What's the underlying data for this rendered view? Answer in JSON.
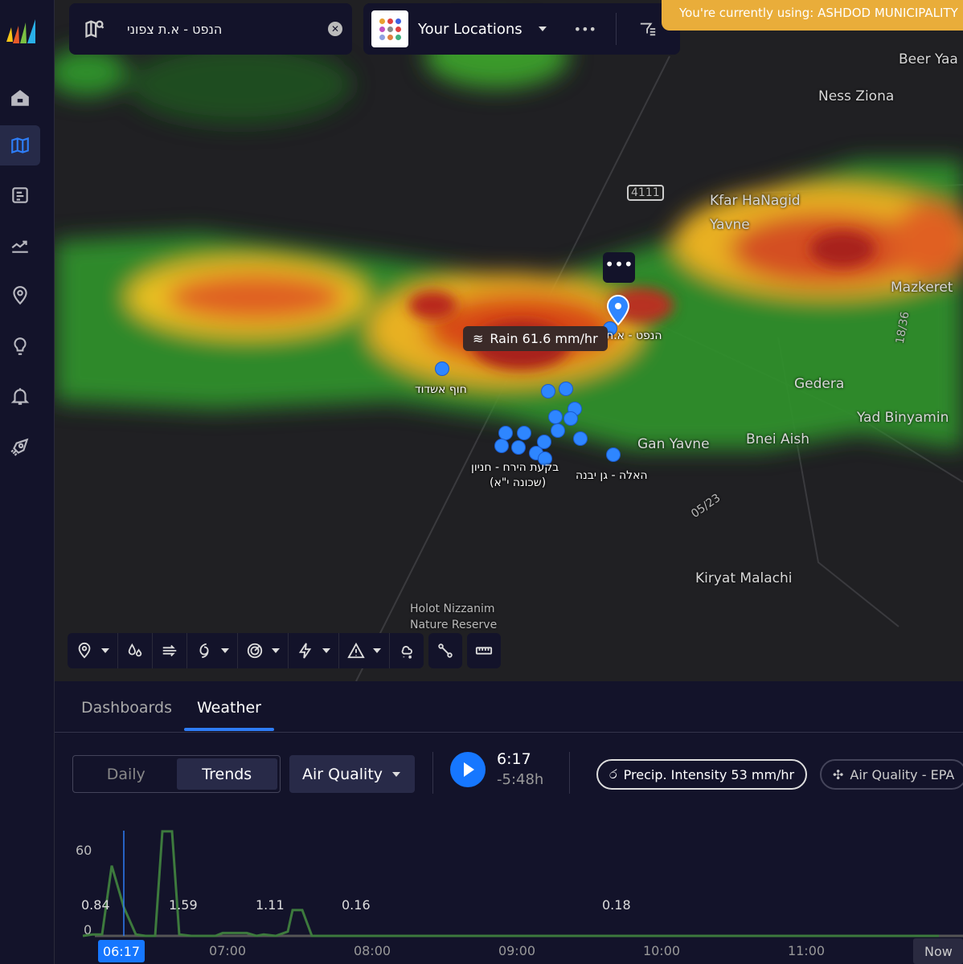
{
  "sidebar": {
    "items": [
      {
        "name": "home",
        "icon": "home-icon"
      },
      {
        "name": "map",
        "icon": "map-icon",
        "active": true
      },
      {
        "name": "reports",
        "icon": "report-icon"
      },
      {
        "name": "trends",
        "icon": "trend-icon"
      },
      {
        "name": "locations",
        "icon": "pin-icon"
      },
      {
        "name": "insights",
        "icon": "lightbulb-icon"
      },
      {
        "name": "alerts",
        "icon": "bell-icon"
      },
      {
        "name": "launch",
        "icon": "rocket-icon"
      }
    ]
  },
  "search": {
    "value": "הנפט - א.ת צפוני"
  },
  "locations": {
    "label": "Your Locations",
    "more": "•••"
  },
  "banner": {
    "text": "You're currently using: ASHDOD MUNICIPALITY"
  },
  "map": {
    "places": [
      "Beer Yaa",
      "Ness Ziona",
      "Kfar HaNagid",
      "Yavne",
      "Mazkeret",
      "Gedera",
      "Yad Binyamin",
      "Gan Yavne",
      "Bnei Aish",
      "Kiryat Malachi",
      "Holot Nizzanim",
      "Nature Reserve",
      "4111",
      "05/23",
      "18/36"
    ],
    "pin_labels": [
      "הנפט - א.ת",
      "חוף אשדוד",
      "בקעת הירח - חניון",
      "(שכונה י\"א)",
      "האלה - גן יבנה"
    ],
    "tooltip": "Rain 61.6 mm/hr",
    "more": "•••"
  },
  "toolbar": [
    "locations",
    "precipitation",
    "wind",
    "tropical",
    "radar",
    "lightning",
    "warnings",
    "winter",
    "route",
    "ruler"
  ],
  "panel": {
    "tabs": [
      "Dashboards",
      "Weather"
    ],
    "active_tab": "Weather",
    "segment": [
      "Daily",
      "Trends"
    ],
    "active_segment": "Trends",
    "dropdown": "Air Quality",
    "time": "6:17",
    "offset": "-5:48h",
    "chips": [
      "Precip. Intensity 53 mm/hr",
      "Air Quality - EPA"
    ]
  },
  "chart_data": {
    "type": "line",
    "y_ticks": [
      "60",
      "0"
    ],
    "x_ticks": [
      "07:00",
      "08:00",
      "09:00",
      "10:00",
      "11:00"
    ],
    "current_time": "06:17",
    "now_label": "Now",
    "data_labels": [
      "0.84",
      "1.59",
      "1.11",
      "0.16",
      "0.18"
    ],
    "series_color": "#3d7a3d",
    "ylim": [
      0,
      60
    ],
    "x": [
      "06:00",
      "06:04",
      "06:08",
      "06:12",
      "06:17",
      "06:22",
      "06:26",
      "06:30",
      "06:33",
      "06:37",
      "06:40",
      "06:45",
      "06:55",
      "06:58",
      "07:08",
      "07:12",
      "07:15",
      "07:20",
      "07:25",
      "07:27",
      "07:31",
      "07:35",
      "11:55"
    ],
    "values": [
      0,
      1,
      1,
      49,
      20,
      1,
      0,
      0,
      73,
      73,
      1,
      0,
      0,
      2,
      2,
      0,
      1,
      0,
      3,
      18,
      18,
      0,
      0
    ]
  }
}
